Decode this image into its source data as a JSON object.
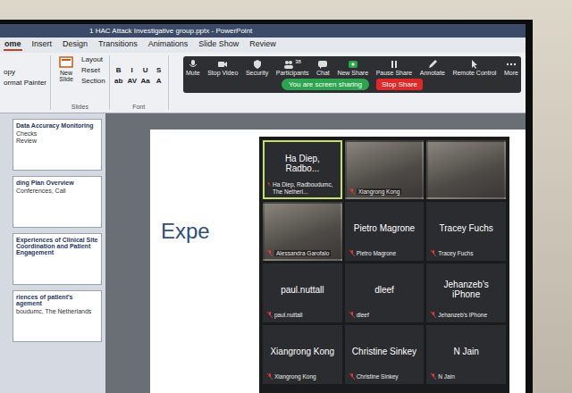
{
  "window": {
    "title": "1 HAC Attack Investigative group.pptx - PowerPoint"
  },
  "ribbon": {
    "tabs": [
      {
        "label": "ome",
        "selected": true
      },
      {
        "label": "Insert",
        "selected": false
      },
      {
        "label": "Design",
        "selected": false
      },
      {
        "label": "Transitions",
        "selected": false
      },
      {
        "label": "Animations",
        "selected": false
      },
      {
        "label": "Slide Show",
        "selected": false
      },
      {
        "label": "Review",
        "selected": false
      }
    ],
    "clipboard": [
      "opy",
      "ormat Painter"
    ],
    "slides_group": {
      "new_slide": "New Slide",
      "items": [
        "Layout",
        "Reset",
        "Section"
      ],
      "caption": "Slides"
    },
    "font_group": {
      "buttons": [
        "B",
        "I",
        "U",
        "S",
        "ab",
        "AV",
        "Aa",
        "A"
      ],
      "caption": "Font"
    }
  },
  "zoom": {
    "buttons": [
      {
        "label": "Mute"
      },
      {
        "label": "Stop Video"
      },
      {
        "label": "Security"
      },
      {
        "label": "Participants",
        "badge": "38"
      },
      {
        "label": "Chat"
      },
      {
        "label": "New Share"
      },
      {
        "label": "Pause Share"
      },
      {
        "label": "Annotate"
      },
      {
        "label": "Remote Control"
      },
      {
        "label": "More"
      }
    ],
    "banner": "You are screen sharing",
    "stop_share": "Stop Share"
  },
  "thumbnails": [
    {
      "title": "Data Accuracy Monitoring",
      "lines": [
        "Checks",
        "Review"
      ],
      "selected": false
    },
    {
      "title": "ding Plan Overview",
      "lines": [
        "Conferences, Call"
      ],
      "selected": false
    },
    {
      "title": "Experiences of Clinical Site Coordination and Patient Engagement",
      "lines": [],
      "selected": false
    },
    {
      "title": "riences of patient's agement",
      "lines": [
        "boudumc, The Netherlands"
      ],
      "selected": false
    }
  ],
  "slide": {
    "title": "Expe"
  },
  "gallery": [
    {
      "kind": "name",
      "name": "Ha Diep, Radbo...",
      "label": "Ha Diep, Radboudumc, The Netherl...",
      "active": true
    },
    {
      "kind": "video",
      "name": "",
      "label": "Xiangrong Kong",
      "active": false
    },
    {
      "kind": "video",
      "name": "",
      "label": "",
      "active": false
    },
    {
      "kind": "video",
      "name": "",
      "label": "Alessandra Garofalo",
      "active": false
    },
    {
      "kind": "name",
      "name": "Pietro Magrone",
      "label": "Pietro Magrone",
      "active": false
    },
    {
      "kind": "name",
      "name": "Tracey Fuchs",
      "label": "Tracey Fuchs",
      "active": false
    },
    {
      "kind": "name",
      "name": "paul.nuttall",
      "label": "paul.nuttall",
      "active": false
    },
    {
      "kind": "name",
      "name": "dleef",
      "label": "dleef",
      "active": false
    },
    {
      "kind": "name",
      "name": "Jehanzeb's iPhone",
      "label": "Jehanzeb's iPhone",
      "active": false
    },
    {
      "kind": "name",
      "name": "Xiangrong Kong",
      "label": "Xiangrong Kong",
      "active": false
    },
    {
      "kind": "name",
      "name": "Christine Sinkey",
      "label": "Christine Sinkey",
      "active": false
    },
    {
      "kind": "name",
      "name": "N Jain",
      "label": "N Jain",
      "active": false
    }
  ]
}
